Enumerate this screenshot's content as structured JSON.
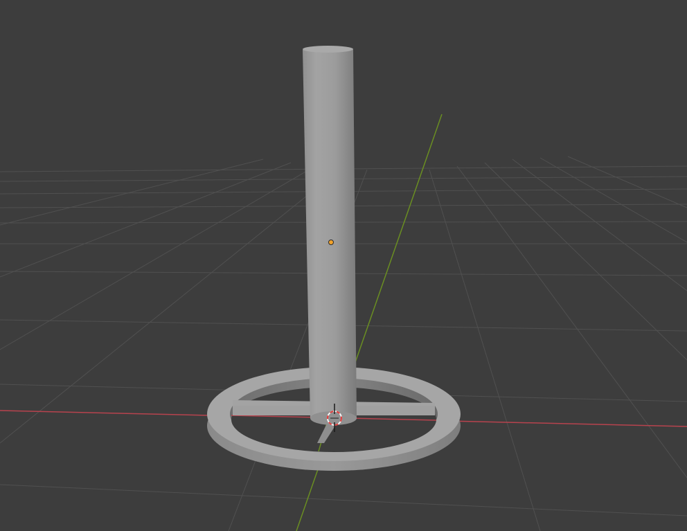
{
  "viewport": {
    "background_color": "#3d3d3d",
    "grid_color": "#535353",
    "x_axis_color": "#b8434e",
    "y_axis_color": "#6a8e22",
    "object_color": "#9a9a9a",
    "origin_color": "#f2a22a",
    "cursor_colors": [
      "#e23b3b",
      "#f5f5f5"
    ],
    "objects": [
      {
        "name": "cylinder",
        "icon": "cylinder-object"
      },
      {
        "name": "base-ring",
        "icon": "torus-ring-object"
      },
      {
        "name": "crossbar",
        "icon": "crossbar-object"
      }
    ],
    "markers": [
      {
        "name": "object-origin",
        "icon": "origin-dot-icon"
      },
      {
        "name": "3d-cursor",
        "icon": "3d-cursor-icon"
      }
    ]
  }
}
